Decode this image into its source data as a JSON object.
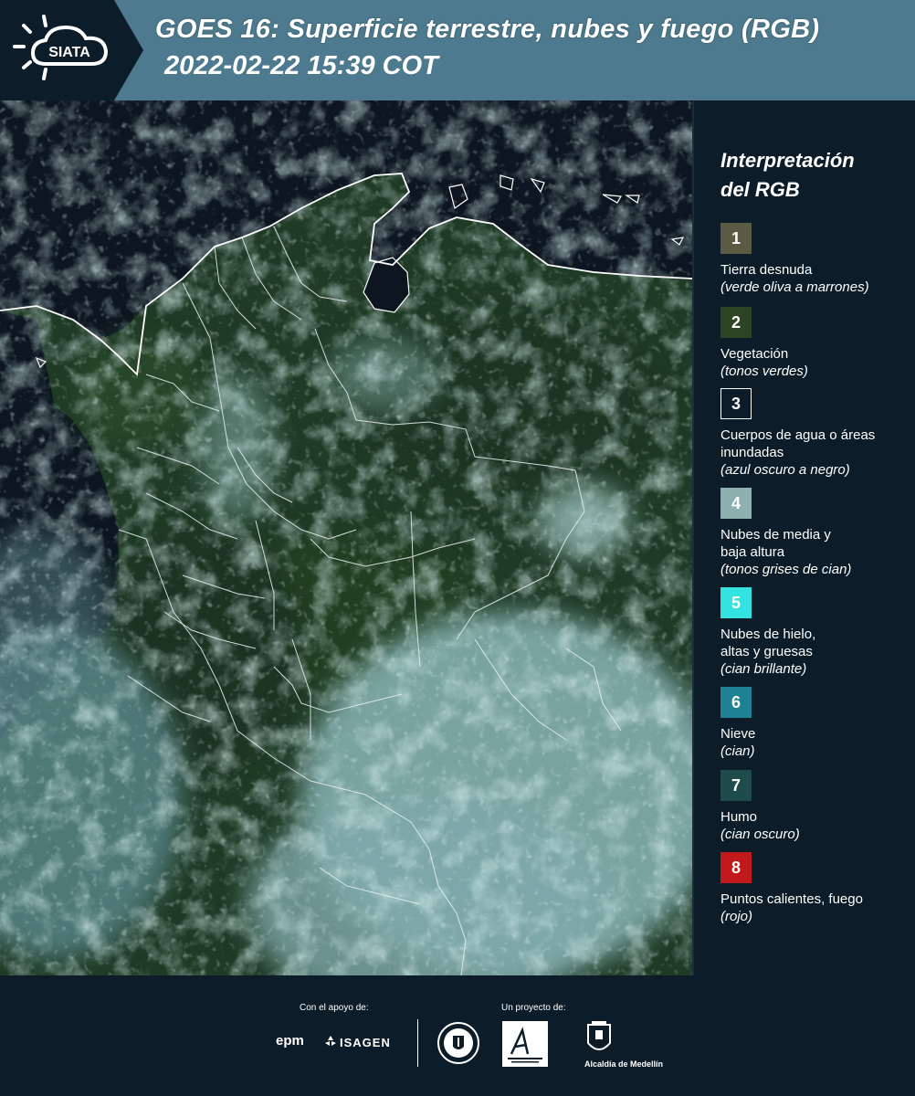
{
  "header": {
    "title": "GOES 16: Superficie terrestre, nubes y fuego (RGB)",
    "datetime": "2022-02-22 15:39 COT",
    "logo_text": "SIATA"
  },
  "legend": {
    "title_line1": "Interpretación",
    "title_line2": "del RGB",
    "items": [
      {
        "number": "1",
        "color": "#5b5a42",
        "label": "Tierra desnuda",
        "note": "(verde oliva a marrones)"
      },
      {
        "number": "2",
        "color": "#2e4523",
        "label": "Vegetación",
        "note": "(tonos verdes)"
      },
      {
        "number": "3",
        "color": "#0c1d29",
        "label": "Cuerpos de agua o áreas inundadas",
        "note": "(azul oscuro a negro)"
      },
      {
        "number": "4",
        "color": "#8fb0b0",
        "label": "Nubes de media y baja altura",
        "note": "(tonos grises de cian)"
      },
      {
        "number": "5",
        "color": "#33e3df",
        "label": "Nubes de hielo, altas y gruesas",
        "note": "(cian brillante)"
      },
      {
        "number": "6",
        "color": "#1f8193",
        "label": "Nieve",
        "note": "(cian)"
      },
      {
        "number": "7",
        "color": "#1d4c4a",
        "label": "Humo",
        "note": "(cian oscuro)"
      },
      {
        "number": "8",
        "color": "#c21a1a",
        "label": "Puntos calientes, fuego",
        "note": "(rojo)"
      }
    ]
  },
  "footer": {
    "support_label": "Con el apoyo de:",
    "project_label": "Un proyecto de:",
    "sponsors": [
      "epm",
      "ISAGEN"
    ],
    "partners": [
      "Área Metropolitana Valle de Aburrá",
      "Alcaldía de Medellín"
    ]
  }
}
